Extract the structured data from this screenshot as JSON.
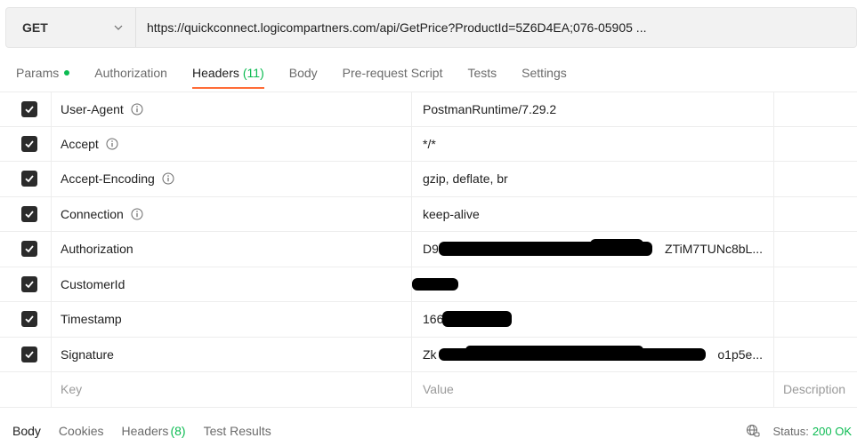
{
  "request": {
    "method": "GET",
    "url": "https://quickconnect.logicompartners.com/api/GetPrice?ProductId=5Z6D4EA;076-05905 ..."
  },
  "tabs": [
    {
      "label": "Params",
      "count": "",
      "active": false
    },
    {
      "label": "Authorization",
      "count": "",
      "active": false
    },
    {
      "label": "Headers",
      "count": "(11)",
      "active": true
    },
    {
      "label": "Body",
      "count": "",
      "active": false
    },
    {
      "label": "Pre-request Script",
      "count": "",
      "active": false
    },
    {
      "label": "Tests",
      "count": "",
      "active": false
    },
    {
      "label": "Settings",
      "count": "",
      "active": false
    }
  ],
  "headers": [
    {
      "key": "User-Agent",
      "value": "PostmanRuntime/7.29.2",
      "info": true
    },
    {
      "key": "Accept",
      "value": "*/*",
      "info": true
    },
    {
      "key": "Accept-Encoding",
      "value": "gzip, deflate, br",
      "info": true
    },
    {
      "key": "Connection",
      "value": "keep-alive",
      "info": true
    },
    {
      "key": "Authorization",
      "value": "D9",
      "value_tail": "ZTiM7TUNc8bL...",
      "info": false
    },
    {
      "key": "CustomerId",
      "value": "",
      "info": false
    },
    {
      "key": "Timestamp",
      "value": "166",
      "info": false
    },
    {
      "key": "Signature",
      "value": "Zk",
      "value_tail": "o1p5e...",
      "info": false
    }
  ],
  "new_row": {
    "key_placeholder": "Key",
    "value_placeholder": "Value",
    "description_placeholder": "Description"
  },
  "response": {
    "tabs": [
      {
        "label": "Body",
        "count": ""
      },
      {
        "label": "Cookies",
        "count": ""
      },
      {
        "label": "Headers",
        "count": "(8)"
      },
      {
        "label": "Test Results",
        "count": ""
      }
    ],
    "status_label": "Status:",
    "status_value": "200 OK"
  },
  "colors": {
    "accent": "#ff6c37",
    "success": "#0cbb52"
  }
}
